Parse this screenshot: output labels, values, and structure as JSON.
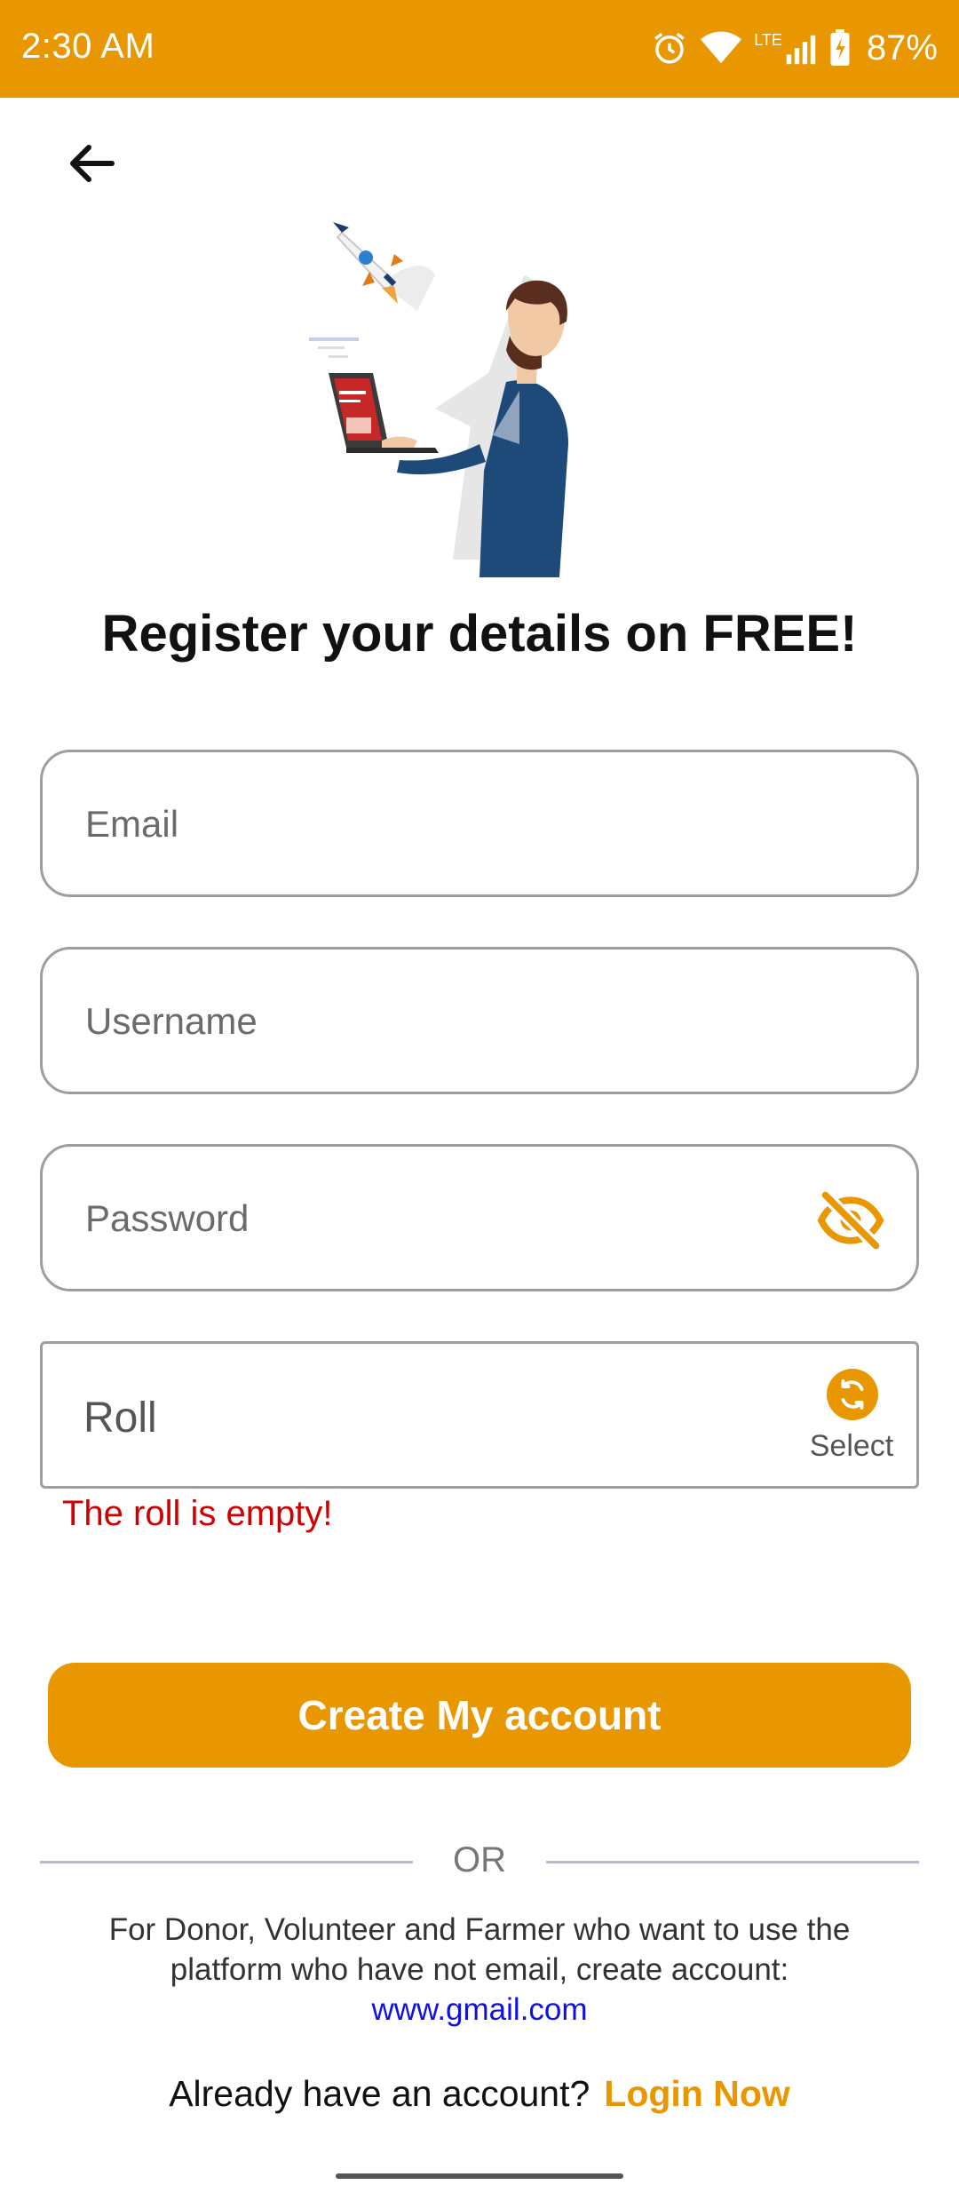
{
  "status_bar": {
    "time": "2:30 AM",
    "network": "LTE",
    "battery": "87%"
  },
  "page": {
    "title": "Register your details on FREE!"
  },
  "form": {
    "email_placeholder": "Email",
    "username_placeholder": "Username",
    "password_placeholder": "Password",
    "roll_label": "Roll",
    "roll_select_label": "Select",
    "roll_error": "The roll is empty!",
    "submit_label": "Create My account"
  },
  "divider": {
    "label": "OR"
  },
  "note": {
    "text": "For Donor, Volunteer and Farmer who want to use the platform who have not email, create account:",
    "link": "www.gmail.com"
  },
  "footer": {
    "prompt": "Already have an account?",
    "login_label": "Login Now"
  },
  "colors": {
    "accent": "#E99700",
    "error": "#D00000",
    "link": "#1010E0"
  }
}
